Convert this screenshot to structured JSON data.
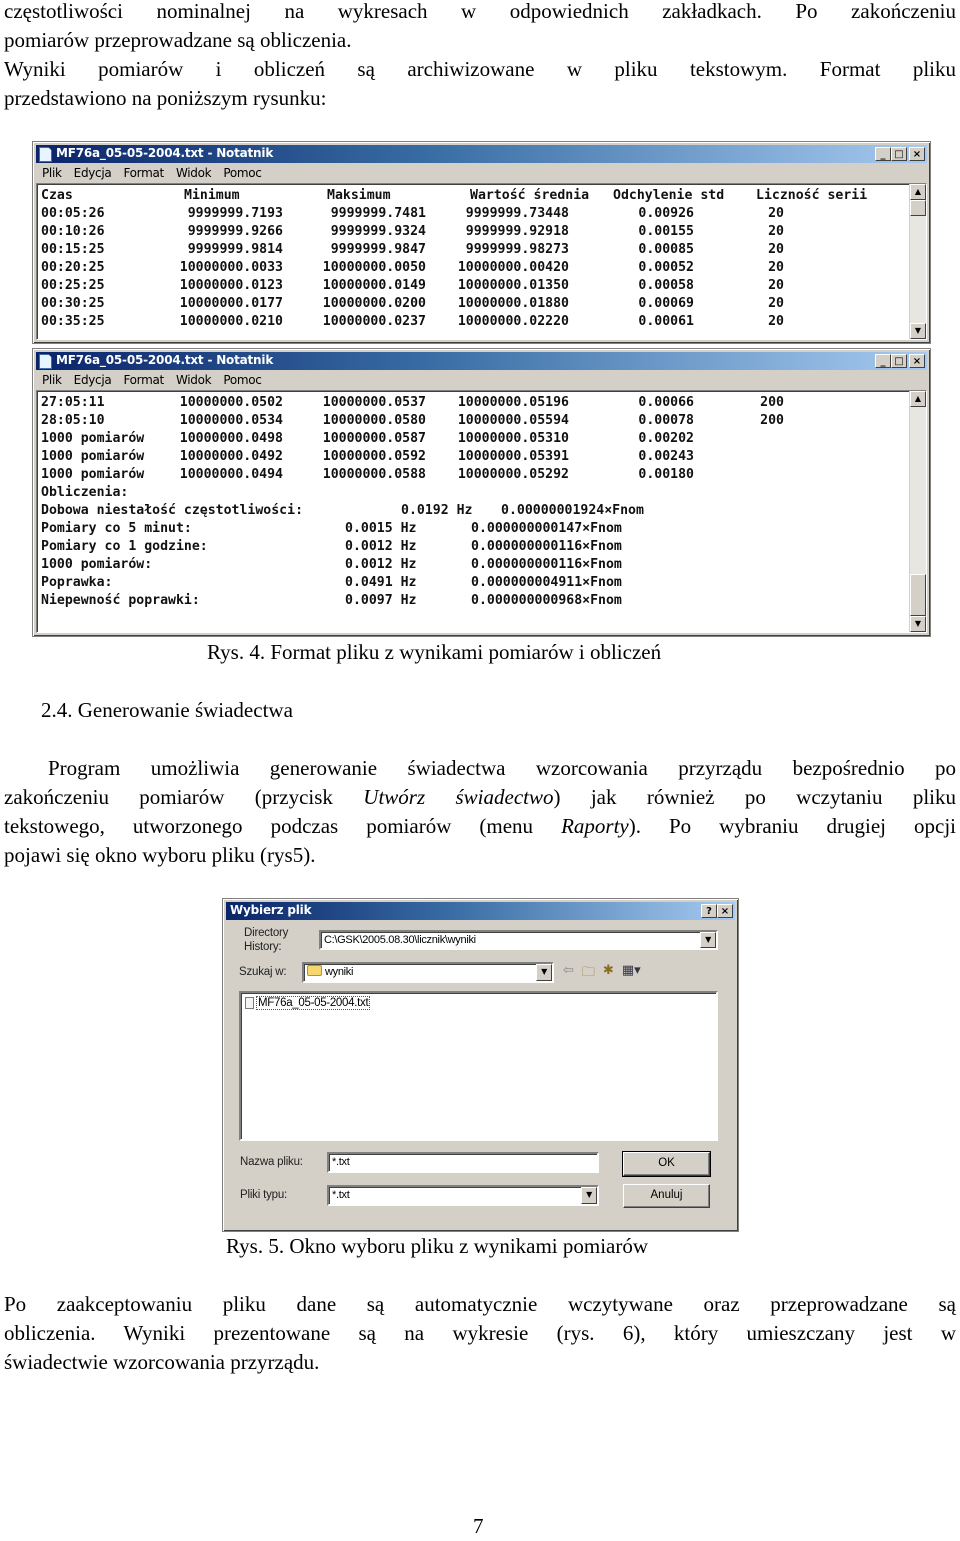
{
  "intro": {
    "line1": "częstotliwości nominalnej na wykresach w odpowiednich zakładkach. Po zakończeniu",
    "line2": "pomiarów przeprowadzane są obliczenia.",
    "line3": "Wyniki pomiarów i obliczeń są archiwizowane w pliku tekstowym. Format pliku",
    "line4": "przedstawiono na poniższym rysunku:"
  },
  "notepad1": {
    "title": "MF76a_05-05-2004.txt - Notatnik",
    "menu": [
      "Plik",
      "Edycja",
      "Format",
      "Widok",
      "Pomoc"
    ],
    "headers": [
      "Czas",
      "Minimum",
      "Maksimum",
      "Wartość średnia",
      "Odchylenie std",
      "Liczność serii"
    ],
    "rows": [
      [
        "00:05:26",
        "9999999.7193",
        "9999999.7481",
        "9999999.73448",
        "0.00926",
        "20"
      ],
      [
        "00:10:26",
        "9999999.9266",
        "9999999.9324",
        "9999999.92918",
        "0.00155",
        "20"
      ],
      [
        "00:15:25",
        "9999999.9814",
        "9999999.9847",
        "9999999.98273",
        "0.00085",
        "20"
      ],
      [
        "00:20:25",
        "10000000.0033",
        "10000000.0050",
        "10000000.00420",
        "0.00052",
        "20"
      ],
      [
        "00:25:25",
        "10000000.0123",
        "10000000.0149",
        "10000000.01350",
        "0.00058",
        "20"
      ],
      [
        "00:30:25",
        "10000000.0177",
        "10000000.0200",
        "10000000.01880",
        "0.00069",
        "20"
      ],
      [
        "00:35:25",
        "10000000.0210",
        "10000000.0237",
        "10000000.02220",
        "0.00061",
        "20"
      ]
    ]
  },
  "notepad2": {
    "title": "MF76a_05-05-2004.txt - Notatnik",
    "menu": [
      "Plik",
      "Edycja",
      "Format",
      "Widok",
      "Pomoc"
    ],
    "rows": [
      [
        "27:05:11",
        "10000000.0502",
        "10000000.0537",
        "10000000.05196",
        "0.00066",
        "200"
      ],
      [
        "28:05:10",
        "10000000.0534",
        "10000000.0580",
        "10000000.05594",
        "0.00078",
        "200"
      ],
      [
        "1000 pomiarów",
        "10000000.0498",
        "10000000.0587",
        "10000000.05310",
        "0.00202",
        ""
      ],
      [
        "1000 pomiarów",
        "10000000.0492",
        "10000000.0592",
        "10000000.05391",
        "0.00243",
        ""
      ],
      [
        "1000 pomiarów",
        "10000000.0494",
        "10000000.0588",
        "10000000.05292",
        "0.00180",
        ""
      ]
    ],
    "calc_heading": "Obliczenia:",
    "calc_daily": {
      "label": "Dobowa niestałość częstotliwości:",
      "hz": "0.0192 Hz",
      "rel": "0.00000001924×Fnom"
    },
    "calcs": [
      {
        "label": "Pomiary co 5 minut:",
        "hz": "0.0015 Hz",
        "rel": "0.000000000147×Fnom"
      },
      {
        "label": "Pomiary co 1 godzine:",
        "hz": "0.0012 Hz",
        "rel": "0.000000000116×Fnom"
      },
      {
        "label": "1000 pomiarów:",
        "hz": "0.0012 Hz",
        "rel": "0.000000000116×Fnom"
      },
      {
        "label": "Poprawka:",
        "hz": "0.0491 Hz",
        "rel": "0.000000004911×Fnom"
      },
      {
        "label": "Niepewność poprawki:",
        "hz": "0.0097 Hz",
        "rel": "0.000000000968×Fnom"
      }
    ]
  },
  "caption4": "Rys. 4. Format pliku z wynikami pomiarów i obliczeń",
  "section": {
    "heading": "2.4. Generowanie świadectwa",
    "p1_l1": "Program umożliwia generowanie świadectwa wzorcowania przyrządu bezpośrednio po",
    "p1_l2a": "zakończeniu pomiarów (przycisk ",
    "p1_l2b": "Utwórz świadectwo",
    "p1_l2c": ") jak również po wczytaniu pliku",
    "p1_l3a": "tekstowego, utworzonego podczas pomiarów (menu ",
    "p1_l3b": "Raporty",
    "p1_l3c": "). Po wybraniu drugiej opcji",
    "p1_l4": "pojawi się okno wyboru pliku (rys5)."
  },
  "dialog": {
    "title": "Wybierz plik",
    "help_btn": "?",
    "close_btn": "×",
    "dir_history_label1": "Directory",
    "dir_history_label2": "History:",
    "dir_history_value": "C:\\GSK\\2005.08.30\\licznik\\wyniki",
    "look_in_label": "Szukaj w:",
    "look_in_value": "wyniki",
    "files": [
      "MF76a_05-05-2004.txt"
    ],
    "filename_label": "Nazwa pliku:",
    "filename_value": "*.txt",
    "filetype_label": "Pliki typu:",
    "filetype_value": "*.txt",
    "ok_label": "OK",
    "cancel_label": "Anuluj"
  },
  "caption5": "Rys. 5. Okno wyboru pliku z wynikami pomiarów",
  "outro": {
    "line1": "Po zaakceptowaniu pliku dane są automatycznie wczytywane oraz przeprowadzane są",
    "line2": "obliczenia. Wyniki prezentowane są na wykresie (rys. 6), który umieszczany jest w",
    "line3": "świadectwie wzorcowania przyrządu."
  },
  "page_number": "7"
}
